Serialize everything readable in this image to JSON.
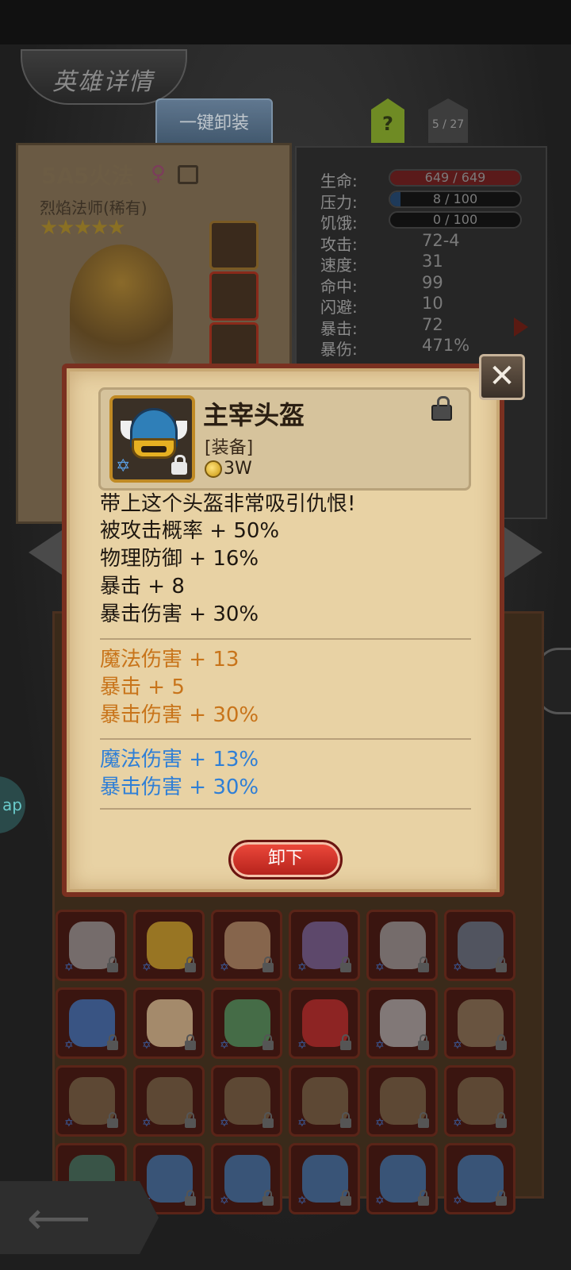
{
  "header": {
    "title": "英雄详情",
    "unequip_all": "一键卸装",
    "help": "?",
    "page": "5 / 27"
  },
  "hero": {
    "name": "5A5火法",
    "gender": "♀",
    "class": "烈焰法师(稀有)",
    "stars": "★★★★★"
  },
  "stats": [
    {
      "label": "生命:",
      "value": "649 / 649",
      "bar": 1.0,
      "color": "#5a1a1a"
    },
    {
      "label": "压力:",
      "value": "8 / 100",
      "bar": 0.08,
      "color": "#1e3a5a"
    },
    {
      "label": "饥饿:",
      "value": "0 / 100",
      "bar": 0.0,
      "color": "#222"
    },
    {
      "label": "攻击:",
      "value": "72-4"
    },
    {
      "label": "速度:",
      "value": "31"
    },
    {
      "label": "命中:",
      "value": "99"
    },
    {
      "label": "闪避:",
      "value": "10"
    },
    {
      "label": "暴击:",
      "value": "72"
    },
    {
      "label": "暴伤:",
      "value": "471%"
    }
  ],
  "modal": {
    "close": "✕",
    "item_name": "主宰头盔",
    "item_type": "[装备]",
    "price": "3W",
    "description": "带上这个头盔非常吸引仇恨!",
    "base_stats": [
      "被攻击概率 + 50%",
      "物理防御 + 16%",
      "暴击 + 8",
      "暴击伤害 + 30%"
    ],
    "orange_stats": [
      "魔法伤害 + 13",
      "暴击 + 5",
      "暴击伤害 + 30%"
    ],
    "blue_stats": [
      "魔法伤害 + 13%",
      "暴击伤害 + 30%"
    ],
    "unequip": "卸下"
  },
  "side": {
    "app_label": "ap"
  },
  "inventory_art": [
    "#8a8a8a",
    "#b8952a",
    "#a08060",
    "#6a5a8a",
    "#8a8a8a",
    "#5a6a7a",
    "#3a6aaa",
    "#c8b28a",
    "#4a8a5a",
    "#aa2a2a",
    "#9a9a9a",
    "#7a6a50",
    "#6a5a40",
    "#6a5a40",
    "#6a5a40",
    "#6a5a40",
    "#6a5a40",
    "#6a5a40",
    "#3a6a5a",
    "#3a6a9a",
    "#3a6a9a",
    "#3a6a9a",
    "#3a6a9a",
    "#3a6a9a"
  ]
}
